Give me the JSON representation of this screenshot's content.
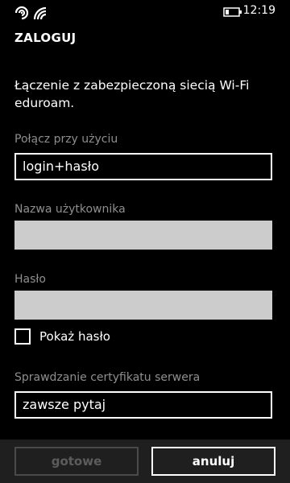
{
  "status_bar": {
    "time": "12:19",
    "icons": [
      "signal-icon",
      "wifi-icon",
      "battery-icon"
    ]
  },
  "page": {
    "title": "ZALOGUJ",
    "intro": "Łączenie z zabezpieczoną siecią Wi-Fi eduroam."
  },
  "fields": {
    "connect_using": {
      "label": "Połącz przy użyciu",
      "value": "login+hasło"
    },
    "username": {
      "label": "Nazwa użytkownika",
      "value": ""
    },
    "password": {
      "label": "Hasło",
      "value": ""
    },
    "show_password": {
      "label": "Pokaż hasło",
      "checked": false
    },
    "cert_check": {
      "label": "Sprawdzanie certyfikatu serwera",
      "value": "zawsze pytaj"
    }
  },
  "app_bar": {
    "done_label": "gotowe",
    "cancel_label": "anuluj"
  },
  "colors": {
    "background": "#000000",
    "field_label": "#8e8e8e",
    "input_fill": "#cccccc",
    "app_bar": "#1f1f1f",
    "disabled_text": "#5c5c5c"
  }
}
